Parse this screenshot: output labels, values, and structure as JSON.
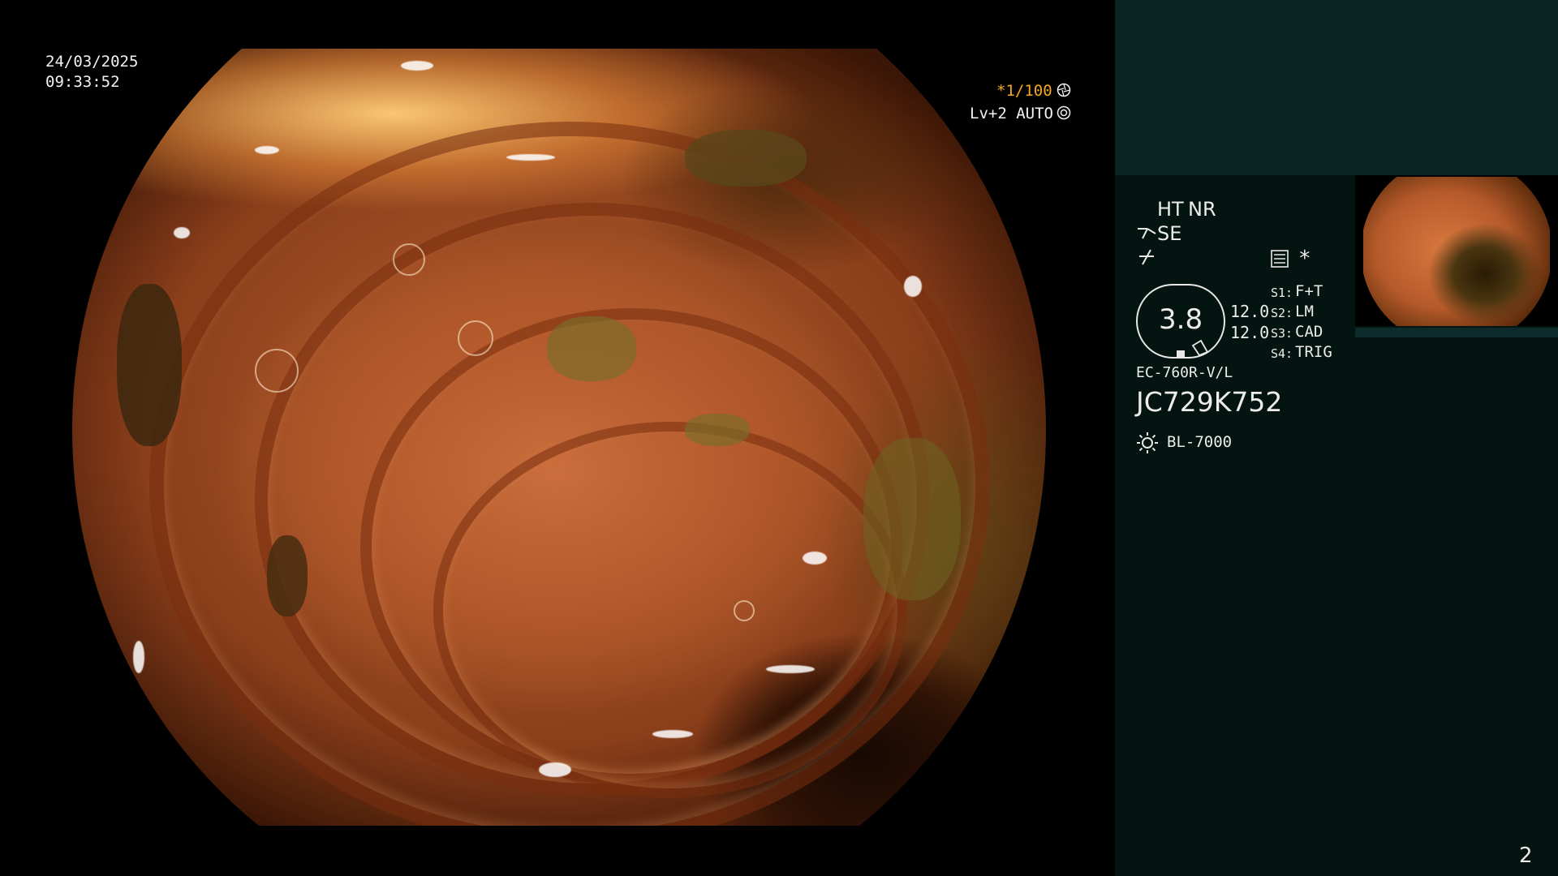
{
  "overlay": {
    "date": "24/03/2025",
    "time": "09:33:52",
    "shutter": "*1/100",
    "level": "Lv+2 AUTO"
  },
  "panel": {
    "ht": "HT",
    "nr": "NR",
    "se": "SE",
    "zoom_value": "3.8",
    "val1": "12.0",
    "val2": "12.0",
    "s1_key": "S1:",
    "s1_val": "F+T",
    "s2_key": "S2:",
    "s2_val": "LM",
    "s3_key": "S3:",
    "s3_val": "CAD",
    "s4_key": "S4:",
    "s4_val": "TRIG",
    "asterisk": "*",
    "scope_model": "EC-760R-V/L",
    "serial": "JC729K752",
    "light_source": "BL-7000",
    "page_number": "2"
  },
  "colors": {
    "accent_orange": "#f5a623",
    "panel_bg": "#041411",
    "panel_top_bg": "#0a2424"
  },
  "icons": [
    "aperture-icon",
    "auto-iris-icon",
    "scope-tip-icon",
    "zigzag-icon",
    "settings-list-icon",
    "light-source-icon"
  ]
}
